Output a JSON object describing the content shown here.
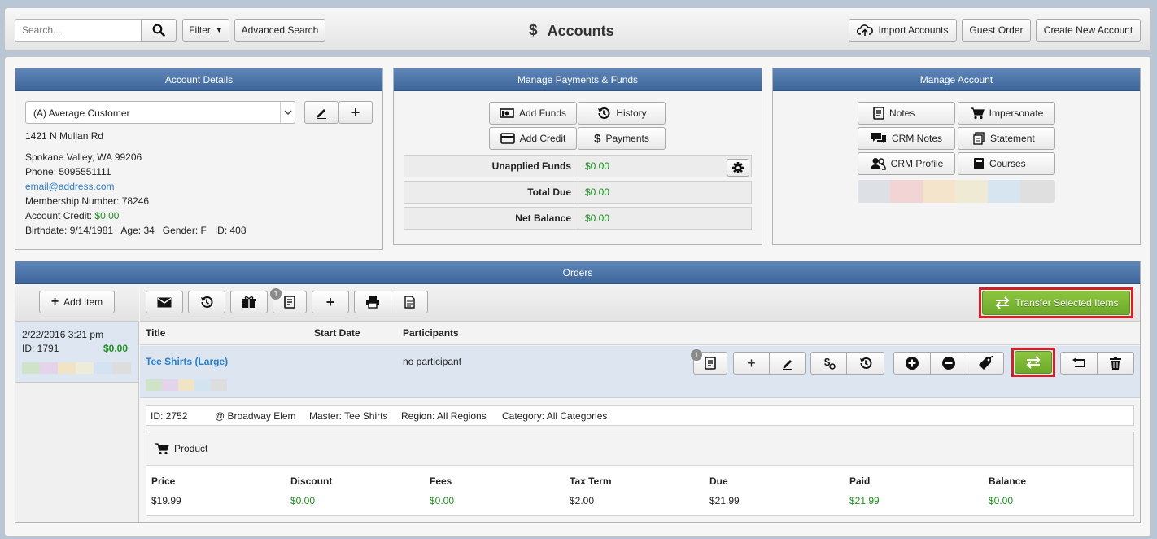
{
  "toolbar": {
    "search_placeholder": "Search...",
    "filter_label": "Filter",
    "advanced_label": "Advanced Search",
    "title": "Accounts",
    "import_label": "Import Accounts",
    "guest_label": "Guest Order",
    "create_label": "Create New Account"
  },
  "account": {
    "header": "Account Details",
    "selected": "(A) Average Customer",
    "address1": "1421 N Mullan Rd",
    "address2": "Spokane Valley, WA 99206",
    "phone": "Phone: 5095551111",
    "email": "email@address.com",
    "membership": "Membership Number: 78246",
    "credit_label": "Account Credit:",
    "credit_value": "$0.00",
    "birth": "Birthdate: 9/14/1981   Age: 34   Gender: F   ID: 408"
  },
  "payments": {
    "header": "Manage Payments & Funds",
    "add_funds": "Add Funds",
    "history": "History",
    "add_credit": "Add Credit",
    "payments": "Payments",
    "rows": [
      {
        "label": "Unapplied Funds",
        "value": "$0.00"
      },
      {
        "label": "Total Due",
        "value": "$0.00"
      },
      {
        "label": "Net Balance",
        "value": "$0.00"
      }
    ]
  },
  "manage": {
    "header": "Manage Account",
    "notes": "Notes",
    "impersonate": "Impersonate",
    "crm_notes": "CRM Notes",
    "statement": "Statement",
    "crm_profile": "CRM Profile",
    "courses": "Courses"
  },
  "orders": {
    "header": "Orders",
    "add_item": "Add Item",
    "notes_badge": "1",
    "transfer_selected": "Transfer Selected Items",
    "order_date": "2/22/2016 3:21 pm",
    "order_id": "ID: 1791",
    "order_total": "$0.00",
    "columns": {
      "title": "Title",
      "start": "Start Date",
      "participants": "Participants"
    },
    "item": {
      "title": "Tee Shirts (Large)",
      "participants": "no participant",
      "badge": "1",
      "details": {
        "id": "ID: 2752",
        "location": "@ Broadway Elem",
        "master": "Master: Tee Shirts",
        "region": "Region: All Regions",
        "category": "Category: All Categories"
      },
      "product_label": "Product",
      "headers": [
        "Price",
        "Discount",
        "Fees",
        "Tax Term",
        "Due",
        "Paid",
        "Balance"
      ],
      "values": [
        "$19.99",
        "$0.00",
        "$0.00",
        "$2.00",
        "$21.99",
        "$21.99",
        "$0.00"
      ]
    }
  },
  "colors": {
    "accent_blue": "#4a72a8",
    "green_value": "#1f8f1f",
    "transfer_green": "#7ab12d",
    "highlight_red": "#d0202a"
  }
}
